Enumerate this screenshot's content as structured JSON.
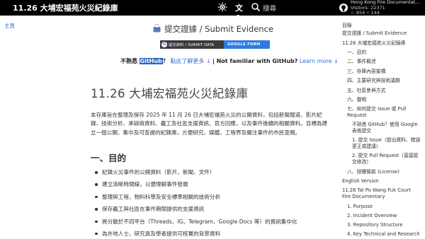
{
  "header": {
    "site_title": "11.26 大埔宏福苑火災紀錄庫",
    "translate_label": "文A",
    "search_label": "搜尋",
    "repo_name": "Hong Kong Fire Documentat...",
    "repo_visitors": "Visitors: 22371",
    "repo_stars": "☆ 854",
    "repo_forks": "⑂ 144"
  },
  "sidebar": {
    "home_label": "主頁"
  },
  "main": {
    "submit_title": "提交證據 / Submit Evidence",
    "badge_left": "提交資料 / SUBMIT DATA",
    "badge_right": "GOOGLE FORM",
    "github_prefix": "不熟悉",
    "github_highlight": "GitHub",
    "github_q": "？",
    "github_zh_link": "點此了解更多 ↓",
    "github_sep": "|",
    "github_en": "Not familiar with GitHub?",
    "github_en_link": "Learn more ↓",
    "page_title": "11.26 大埔宏福苑火災紀錄庫",
    "intro": "本存庫旨在整理及保存 2025 年 11 月 26 日大埔宏福苑火災的公開資料，包括新聞報道、影片紀錄、技術分析、承辦商資料、義工及社區支援資訊、官方回應，以及事件後續的相關資料。目標為建立一個公開、集中及可查證的紀錄庫，方便研究、媒體、工程界及關注事件的市民查閱。",
    "section_heading": "一、目的",
    "bullets": [
      "紀錄火災事件的公開資料（影片、新聞、文件）",
      "建立清晰時間線，以便理解事件發展",
      "整理與工程、物料科學及安全標準相關的技術分析",
      "保存義工與社區在事件期間提供的支援資訊",
      "將分散於不同平台（Threads、IG、Telegram、Google Docs 等）的資訊集中化",
      "為外地人士、研究員及學者提供可核實的背景資料"
    ]
  },
  "toc": {
    "title": "目錄",
    "items": [
      "提交證據 / Submit Evidence",
      "11.26 大埔宏福苑火災紀錄庫",
      "一、目的",
      "二、事件概述",
      "三、存庫內容架構",
      "四、主要研究與技術議題",
      "五、社區參與方式",
      "六、聲明",
      "七、如何提交 Issue 或 Pull Request",
      "不熟悉 GitHub？使用 Google 表格提交",
      "1. 提交 Issue（提出資料、錯誤更正或建議）",
      "2. 提交 Pull Request（直接提交修改）",
      "八、授權條款 (License)",
      "English Version",
      "11.26 Tai Po Wang Fuk Court Fire Documentary",
      "1. Purpose",
      "2. Incident Overview",
      "3. Repository Structure",
      "4. Key Technical and Research"
    ]
  },
  "colors": {
    "header_bg": "#000000",
    "link": "#2f6fd0",
    "badge_dark": "#3b3b3b",
    "badge_blue": "#2d7be0"
  }
}
